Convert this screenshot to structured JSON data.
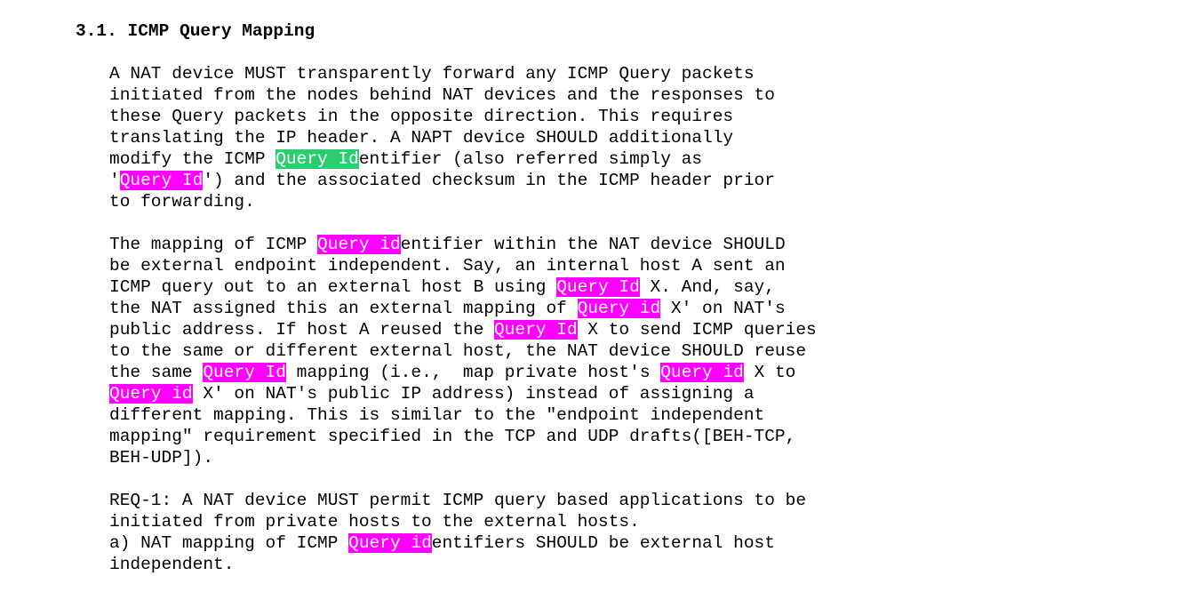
{
  "heading": "3.1. ICMP Query Mapping",
  "colors": {
    "highlight_magenta": "#ff00ff",
    "highlight_green": "#2ecc71"
  },
  "lines": [
    [
      {
        "t": "A NAT device MUST transparently forward any ICMP Query packets"
      }
    ],
    [
      {
        "t": "initiated from the nodes behind NAT devices and the responses to"
      }
    ],
    [
      {
        "t": "these Query packets in the opposite direction. This requires"
      }
    ],
    [
      {
        "t": "translating the IP header. A NAPT device SHOULD additionally"
      }
    ],
    [
      {
        "t": "modify the ICMP "
      },
      {
        "t": "Query Id",
        "hl": "green"
      },
      {
        "t": "entifier (also referred simply as"
      }
    ],
    [
      {
        "t": "'"
      },
      {
        "t": "Query Id",
        "hl": "magenta"
      },
      {
        "t": "') and the associated checksum in the ICMP header prior"
      }
    ],
    [
      {
        "t": "to forwarding."
      }
    ],
    [],
    [
      {
        "t": "The mapping of ICMP "
      },
      {
        "t": "Query id",
        "hl": "magenta"
      },
      {
        "t": "entifier within the NAT device SHOULD"
      }
    ],
    [
      {
        "t": "be external endpoint independent. Say, an internal host A sent an"
      }
    ],
    [
      {
        "t": "ICMP query out to an external host B using "
      },
      {
        "t": "Query Id",
        "hl": "magenta"
      },
      {
        "t": " X. And, say,"
      }
    ],
    [
      {
        "t": "the NAT assigned this an external mapping of "
      },
      {
        "t": "Query id",
        "hl": "magenta"
      },
      {
        "t": " X' on NAT's"
      }
    ],
    [
      {
        "t": "public address. If host A reused the "
      },
      {
        "t": "Query Id",
        "hl": "magenta"
      },
      {
        "t": " X to send ICMP queries"
      }
    ],
    [
      {
        "t": "to the same or different external host, the NAT device SHOULD reuse"
      }
    ],
    [
      {
        "t": "the same "
      },
      {
        "t": "Query Id",
        "hl": "magenta"
      },
      {
        "t": " mapping (i.e.,  map private host's "
      },
      {
        "t": "Query id",
        "hl": "magenta"
      },
      {
        "t": " X to"
      }
    ],
    [
      {
        "t": "Query id",
        "hl": "magenta"
      },
      {
        "t": " X' on NAT's public IP address) instead of assigning a"
      }
    ],
    [
      {
        "t": "different mapping. This is similar to the \"endpoint independent"
      }
    ],
    [
      {
        "t": "mapping\" requirement specified in the TCP and UDP drafts([BEH-TCP,"
      }
    ],
    [
      {
        "t": "BEH-UDP])."
      }
    ],
    [],
    [
      {
        "t": "REQ-1: A NAT device MUST permit ICMP query based applications to be"
      }
    ],
    [
      {
        "t": "initiated from private hosts to the external hosts."
      }
    ],
    [
      {
        "t": "a) NAT mapping of ICMP "
      },
      {
        "t": "Query id",
        "hl": "magenta"
      },
      {
        "t": "entifiers SHOULD be external host"
      }
    ],
    [
      {
        "t": "independent."
      }
    ]
  ]
}
